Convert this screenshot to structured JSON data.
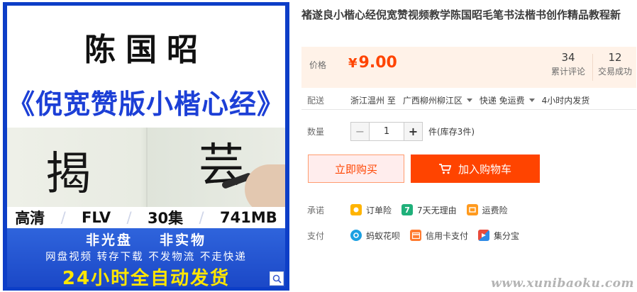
{
  "image": {
    "teacher": "陈国昭",
    "course": "《倪宽赞版小楷心经》",
    "sample_chars": [
      "揭",
      "芸"
    ],
    "spec": [
      "高清",
      "FLV",
      "30集",
      "741MB"
    ],
    "banner_line1": [
      "非光盘",
      "非实物"
    ],
    "banner_line2": "网盘视频 转存下载 不发物流 不走快递",
    "banner_line3": "24小时全自动发货",
    "brand_blue": "#1b48c7",
    "highlight_yellow": "#ffe600",
    "zoom_icon": "magnifier-icon"
  },
  "product": {
    "title": "褚遂良小楷心经倪宽赞视频教学陈国昭毛笔书法楷书创作精品教程新"
  },
  "price": {
    "label": "价格",
    "currency": "¥",
    "value": "9.00",
    "color": "#ff4400"
  },
  "stats": {
    "reviews_count": "34",
    "reviews_label": "累计评论",
    "deals_count": "12",
    "deals_label": "交易成功"
  },
  "delivery": {
    "label": "配送",
    "from": "浙江温州 至",
    "to": "广西柳州柳江区",
    "shipping": "快递 免运费",
    "dispatch": "4小时内发货"
  },
  "quantity": {
    "label": "数量",
    "value": "1",
    "minus": "−",
    "plus": "+",
    "stock": "件(库存3件)"
  },
  "actions": {
    "buy_now": "立即购买",
    "add_to_cart": "加入购物车"
  },
  "promise": {
    "label": "承诺",
    "items": [
      {
        "icon": "order-insurance-icon",
        "text": "订单险",
        "color": "#ffb400"
      },
      {
        "icon": "seven-day-return-icon",
        "text": "7天无理由",
        "color": "#1fb07a"
      },
      {
        "icon": "shipping-insurance-icon",
        "text": "运费险",
        "color": "#ff9a1e"
      }
    ]
  },
  "payment": {
    "label": "支付",
    "items": [
      {
        "icon": "huabei-icon",
        "text": "蚂蚁花呗",
        "color": "#1ba0e2"
      },
      {
        "icon": "credit-card-icon",
        "text": "信用卡支付",
        "color": "#ff7a2f"
      },
      {
        "icon": "jifenbao-icon",
        "text": "集分宝",
        "color": "#e84b3c"
      }
    ]
  },
  "watermark": "www.xunibaoku.com"
}
